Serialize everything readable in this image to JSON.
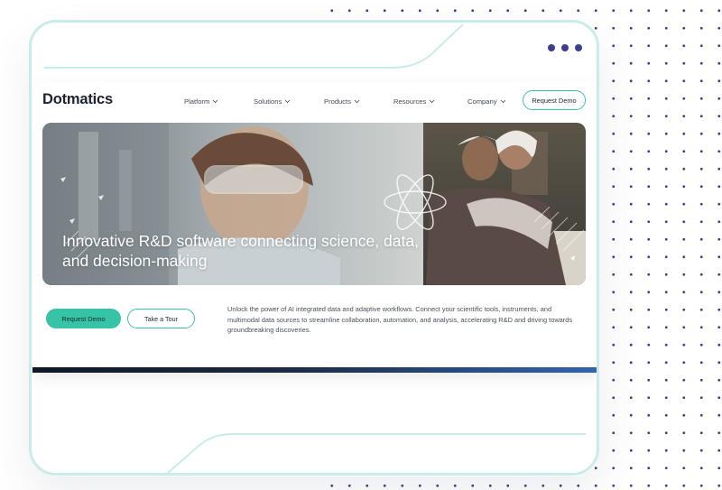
{
  "colors": {
    "accent": "#37c3a6",
    "frame_border": "#c8ece7",
    "dots": "#3b3f8f",
    "text_dark": "#1d2130"
  },
  "site": {
    "logo": "Dotmatics",
    "nav": {
      "items": [
        {
          "label": "Platform",
          "icon": "chevron-down-icon"
        },
        {
          "label": "Solutions",
          "icon": "chevron-down-icon"
        },
        {
          "label": "Products",
          "icon": "chevron-down-icon"
        },
        {
          "label": "Resources",
          "icon": "chevron-down-icon"
        },
        {
          "label": "Company",
          "icon": "chevron-down-icon"
        }
      ],
      "cta_label": "Request Demo"
    },
    "hero": {
      "title": "Innovative R&D software connecting science, data, and decision-making"
    },
    "actions": {
      "primary_label": "Request Demo",
      "secondary_label": "Take a Tour"
    },
    "description": "Unlock the power of AI integrated data and adaptive workflows. Connect your scientific tools, instruments, and multimodal data sources to streamline collaboration, automation, and analysis, accelerating R&D and driving towards groundbreaking discoveries."
  }
}
